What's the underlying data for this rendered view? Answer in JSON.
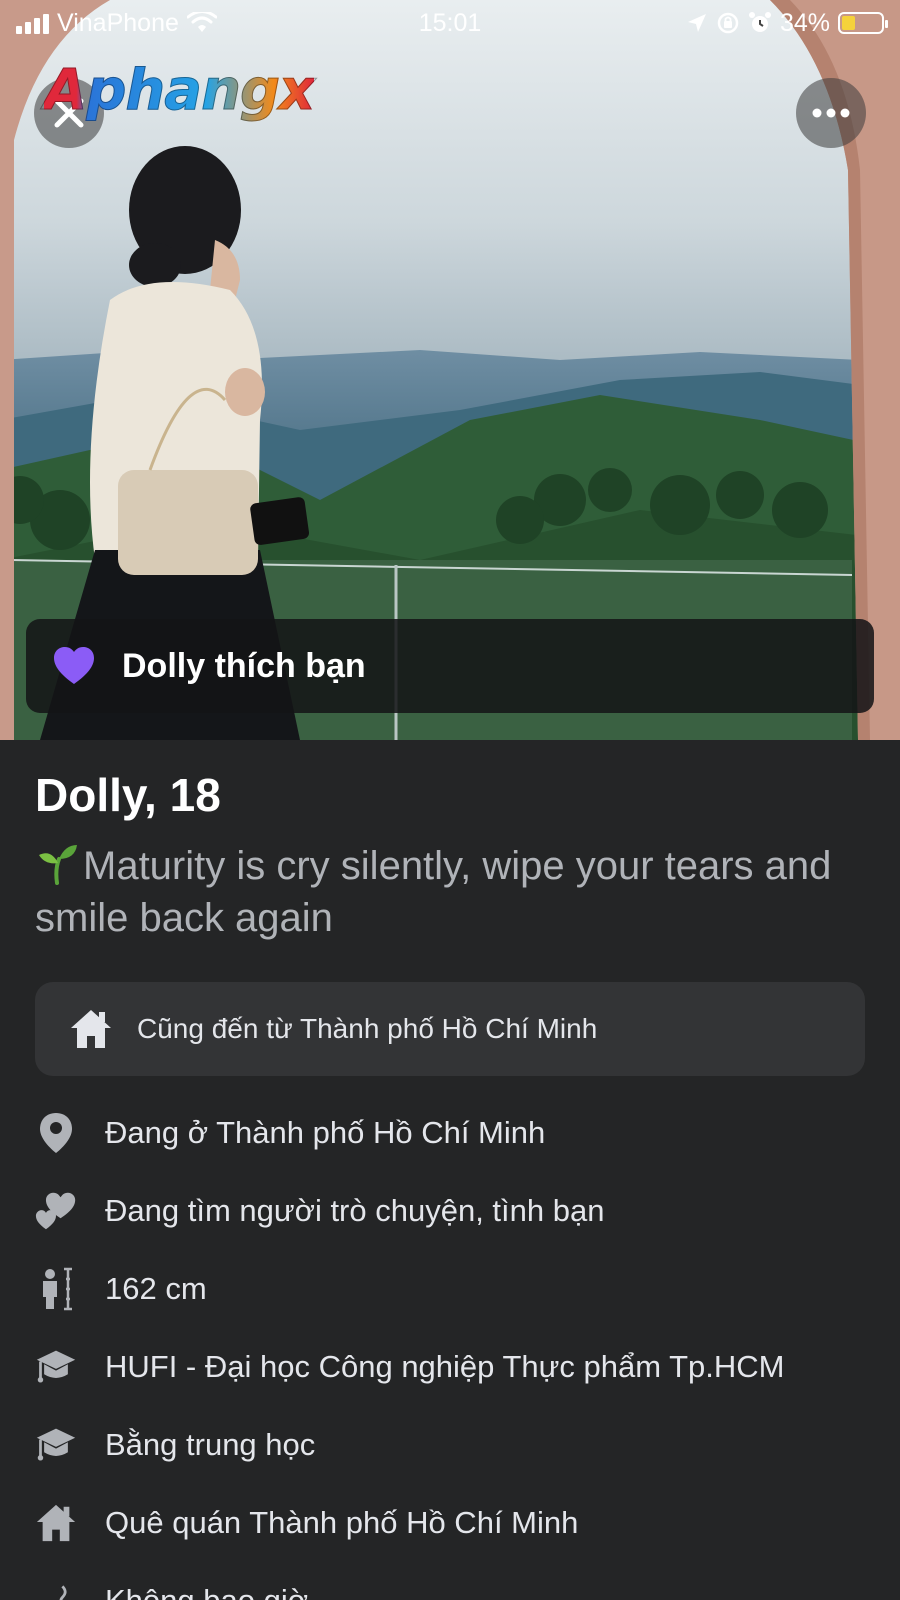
{
  "status_bar": {
    "carrier": "VinaPhone",
    "time": "15:01",
    "battery_percent": "34%",
    "battery_level": 0.34
  },
  "watermark": {
    "logo_text": "Aphangx"
  },
  "header": {
    "close_icon": "close-icon",
    "more_icon": "more-icon"
  },
  "like_banner": {
    "icon": "heart-icon",
    "text": "Dolly thích bạn",
    "color": "#8b5cf6"
  },
  "profile": {
    "name_age": "Dolly, 18",
    "bio": "Maturity is cry silently, wipe your tears and smile back again",
    "bio_icon": "sprout-icon",
    "hometown_highlight": "Cũng đến từ Thành phố Hồ Chí Minh",
    "details": [
      {
        "icon": "location-pin-icon",
        "text": "Đang ở Thành phố Hồ Chí Minh"
      },
      {
        "icon": "hearts-icon",
        "text": "Đang tìm người trò chuyện, tình bạn"
      },
      {
        "icon": "height-icon",
        "text": "162 cm"
      },
      {
        "icon": "graduation-cap-icon",
        "text": "HUFI - Đại học Công nghiệp Thực phẩm Tp.HCM"
      },
      {
        "icon": "graduation-cap-icon",
        "text": "Bằng trung học"
      },
      {
        "icon": "home-icon",
        "text": "Quê quán Thành phố Hồ Chí Minh"
      },
      {
        "icon": "smoking-icon",
        "text": "Không bao giờ"
      }
    ]
  },
  "colors": {
    "background": "#242526",
    "card": "#333436",
    "text": "#e4e6eb",
    "muted": "#b0b3b8"
  }
}
